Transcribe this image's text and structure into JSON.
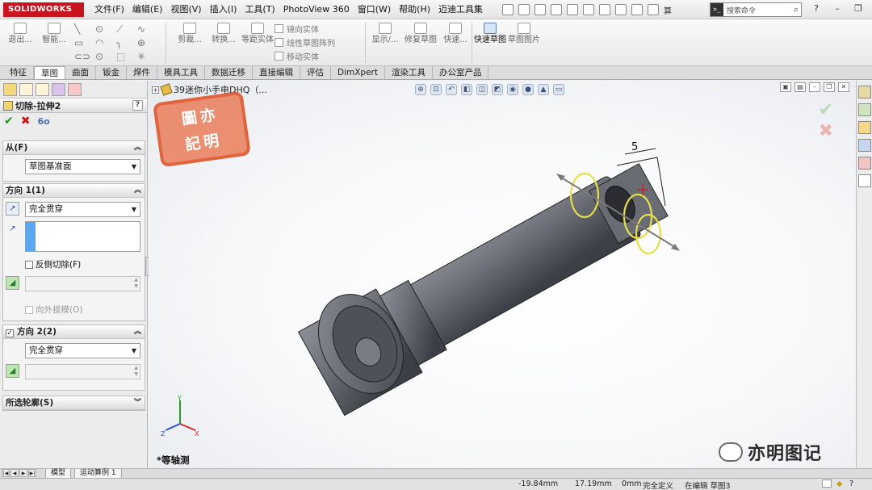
{
  "app": {
    "logo_text": "SOLIDWORKS"
  },
  "menu": [
    "文件(F)",
    "编辑(E)",
    "视图(V)",
    "插入(I)",
    "工具(T)",
    "PhotoView 360",
    "窗口(W)",
    "帮助(H)",
    "迈迪工具集",
    "算"
  ],
  "search": {
    "placeholder": "搜索命令"
  },
  "commands": {
    "exit_sketch": "退出...",
    "smart_dim": "智能...",
    "trim": "剪裁...",
    "convert": "转换...",
    "offset": "等距实体",
    "mirror": "镜向实体",
    "linear_pattern": "线性草图阵列",
    "move": "移动实体",
    "display": "显示/...",
    "repair": "修复草图",
    "quick": "快速...",
    "quick_sketch": "快速草图",
    "sketch_picture": "草图图片"
  },
  "tabs": [
    "特征",
    "草图",
    "曲面",
    "钣金",
    "焊件",
    "模具工具",
    "数据迁移",
    "直接编辑",
    "评估",
    "DimXpert",
    "渲染工具",
    "办公室产品"
  ],
  "active_tab": 1,
  "property_manager": {
    "title": "切除-拉伸2",
    "help": "?",
    "from": {
      "label": "从(F)",
      "value": "草图基准面"
    },
    "dir1": {
      "label": "方向 1(1)",
      "end_condition": "完全贯穿",
      "flip": "反侧切除(F)",
      "draft": "向外拔模(O)"
    },
    "dir2": {
      "label": "方向 2(2)",
      "end_condition": "完全贯穿"
    },
    "contours": {
      "label": "所选轮廓(S)"
    }
  },
  "viewport": {
    "tree_label": "39迷你小手电DHQ（...",
    "view_orientation": "*等轴测",
    "dimension_label": "5",
    "stamp": {
      "top": "圖亦",
      "bottom": "記明"
    },
    "watermark": "亦明图记",
    "triad": {
      "x": "X",
      "y": "Y",
      "z": "Z"
    }
  },
  "bottom_tabs": [
    "模型",
    "运动算例 1"
  ],
  "status": {
    "x": "-19.84mm",
    "y": "17.19mm",
    "z": "0mm",
    "state": "完全定义",
    "editing": "在编辑 草图3"
  },
  "colors": {
    "accent": "#c8141e",
    "part": "#6e7078",
    "selection": "#e5e04a",
    "stamp": "#e0653f"
  }
}
